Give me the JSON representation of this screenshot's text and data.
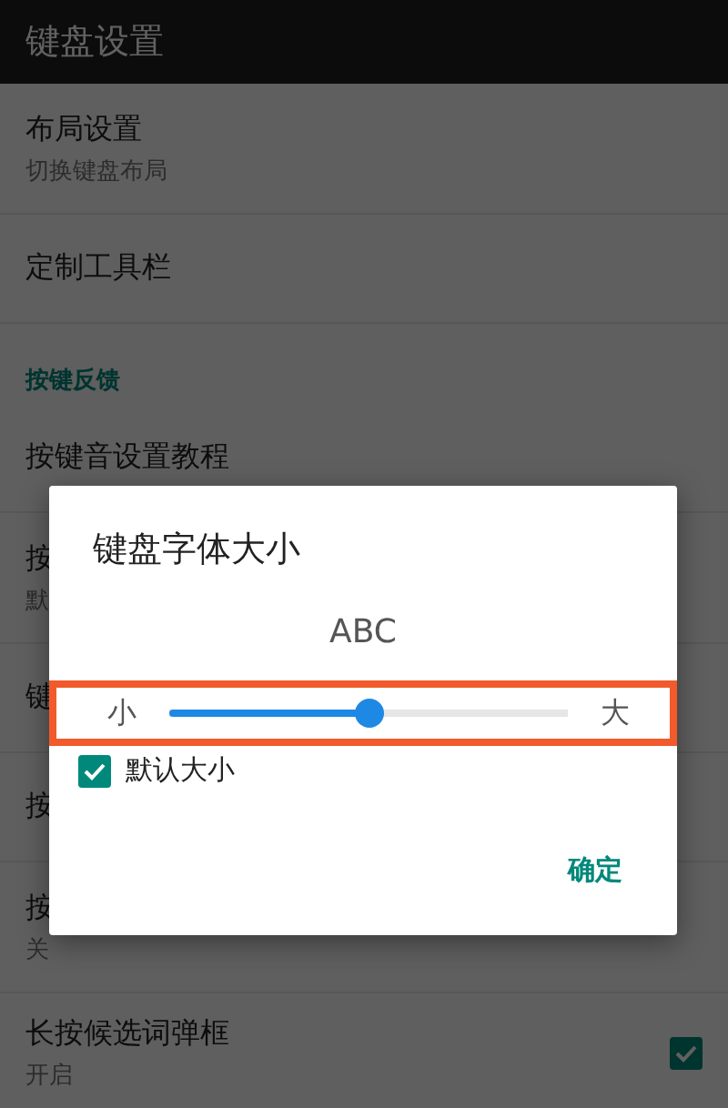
{
  "app_bar": {
    "title": "键盘设置"
  },
  "settings": [
    {
      "kind": "item",
      "title": "布局设置",
      "subtitle": "切换键盘布局"
    },
    {
      "kind": "item",
      "title": "定制工具栏"
    },
    {
      "kind": "section",
      "title": "按键反馈"
    },
    {
      "kind": "item",
      "title": "按键音设置教程"
    },
    {
      "kind": "item",
      "title": "按",
      "subtitle": "默"
    },
    {
      "kind": "item",
      "title": "键"
    },
    {
      "kind": "item",
      "title": "按"
    },
    {
      "kind": "item",
      "title": "按",
      "subtitle": "关"
    },
    {
      "kind": "toggle",
      "title": "长按候选词弹框",
      "subtitle": "开启",
      "checked": true
    }
  ],
  "dialog": {
    "title": "键盘字体大小",
    "preview": "ABC",
    "slider": {
      "min_label": "小",
      "max_label": "大",
      "level": 0.5,
      "highlighted": true
    },
    "checkbox": {
      "label": "默认大小",
      "checked": true
    },
    "button": "确定"
  }
}
